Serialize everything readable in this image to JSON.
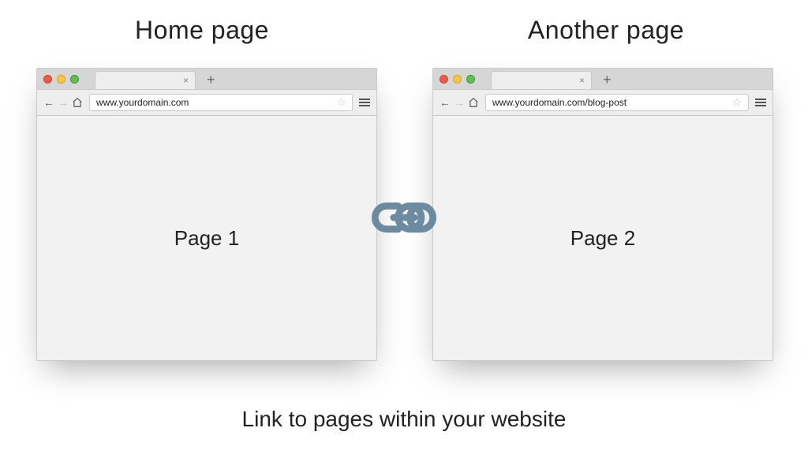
{
  "headings": {
    "left": "Home page",
    "right": "Another page"
  },
  "browsers": [
    {
      "tab_close": "×",
      "new_tab": "+",
      "url": "www.yourdomain.com",
      "content_label": "Page 1"
    },
    {
      "tab_close": "×",
      "new_tab": "+",
      "url": "www.yourdomain.com/blog-post",
      "content_label": "Page 2"
    }
  ],
  "caption": "Link to pages within your website",
  "icons": {
    "back": "←",
    "forward": "→",
    "star": "☆"
  },
  "colors": {
    "link_icon": "#6c8ba0"
  }
}
